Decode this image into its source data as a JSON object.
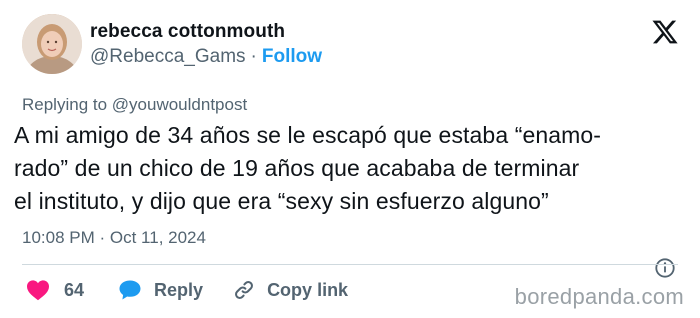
{
  "user": {
    "display_name": "rebecca cottonmouth",
    "handle": "@Rebecca_Gams",
    "separator": "·",
    "follow_label": "Follow"
  },
  "reply": {
    "prefix": "Replying to ",
    "target": "@youwouldntpost"
  },
  "tweet": {
    "text": "A mi amigo de 34 años se le escapó que estaba “enamo-\nrado” de un chico de 19 años que acababa de terminar\nel instituto, y dijo que era “sexy sin esfuerzo alguno”",
    "time": "10:08 PM · Oct 11, 2024"
  },
  "actions": {
    "like_count": "64",
    "reply_label": "Reply",
    "copy_link_label": "Copy link"
  },
  "watermark": "boredpanda.com",
  "colors": {
    "accent": "#1d9bf0",
    "like": "#f91880",
    "text": "#0f1419",
    "muted": "#536471"
  },
  "icons": {
    "brand": "x-logo-icon",
    "info": "info-icon",
    "like": "heart-icon",
    "reply": "reply-bubble-icon",
    "copy": "link-icon"
  }
}
